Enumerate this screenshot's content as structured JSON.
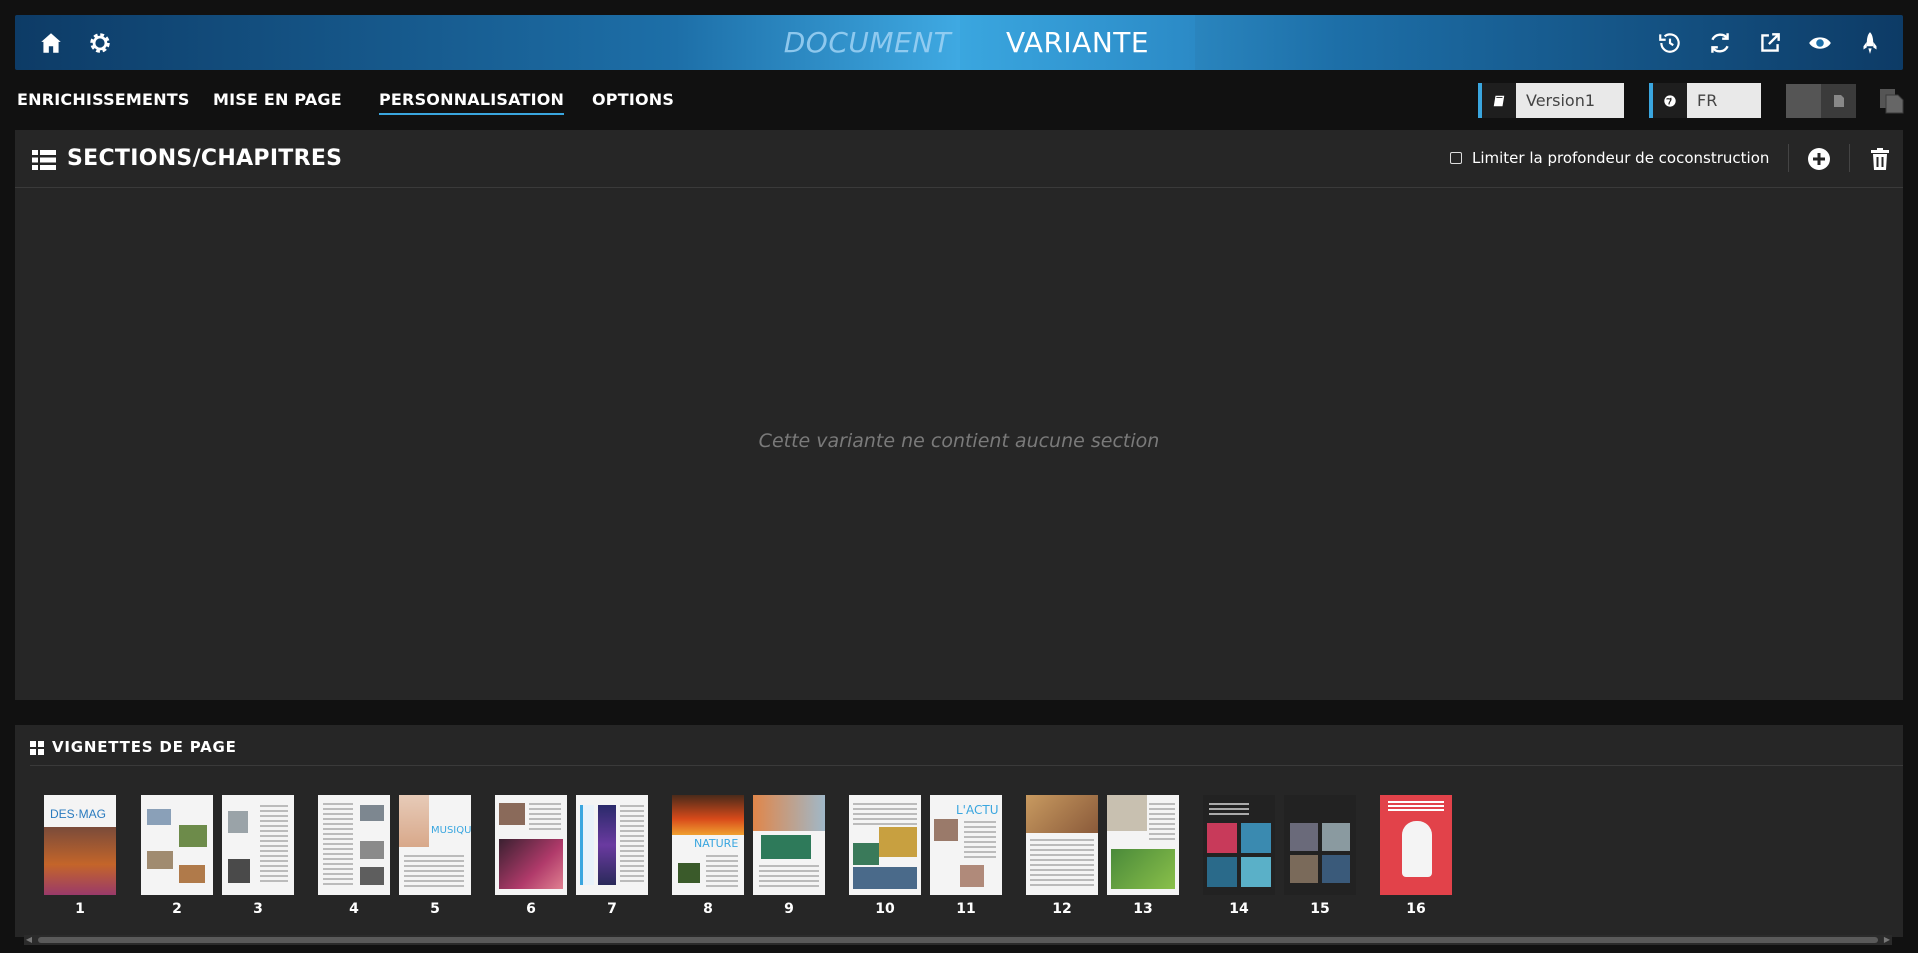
{
  "header": {
    "mode_tabs": {
      "document": "DOCUMENT",
      "variante": "VARIANTE"
    },
    "left_icons": [
      "home-icon",
      "gear-icon"
    ],
    "right_icons": [
      "history-icon",
      "refresh-icon",
      "external-link-icon",
      "eye-icon",
      "rocket-icon"
    ]
  },
  "menu": {
    "items": [
      "ENRICHISSEMENTS",
      "MISE EN PAGE",
      "PERSONNALISATION",
      "OPTIONS"
    ],
    "active": "PERSONNALISATION"
  },
  "toolbar": {
    "version": "Version1",
    "language": "FR"
  },
  "sections": {
    "title": "SECTIONS/CHAPITRES",
    "checkbox_label": "Limiter la profondeur de coconstruction",
    "checkbox_checked": false,
    "empty_message": "Cette variante ne contient aucune section"
  },
  "thumbnails": {
    "title": "VIGNETTES DE PAGE",
    "pages": [
      "1",
      "2",
      "3",
      "4",
      "5",
      "6",
      "7",
      "8",
      "9",
      "10",
      "11",
      "12",
      "13",
      "14",
      "15",
      "16"
    ]
  },
  "colors": {
    "accent": "#3aa6df",
    "panel": "#262626",
    "background": "#111111"
  }
}
